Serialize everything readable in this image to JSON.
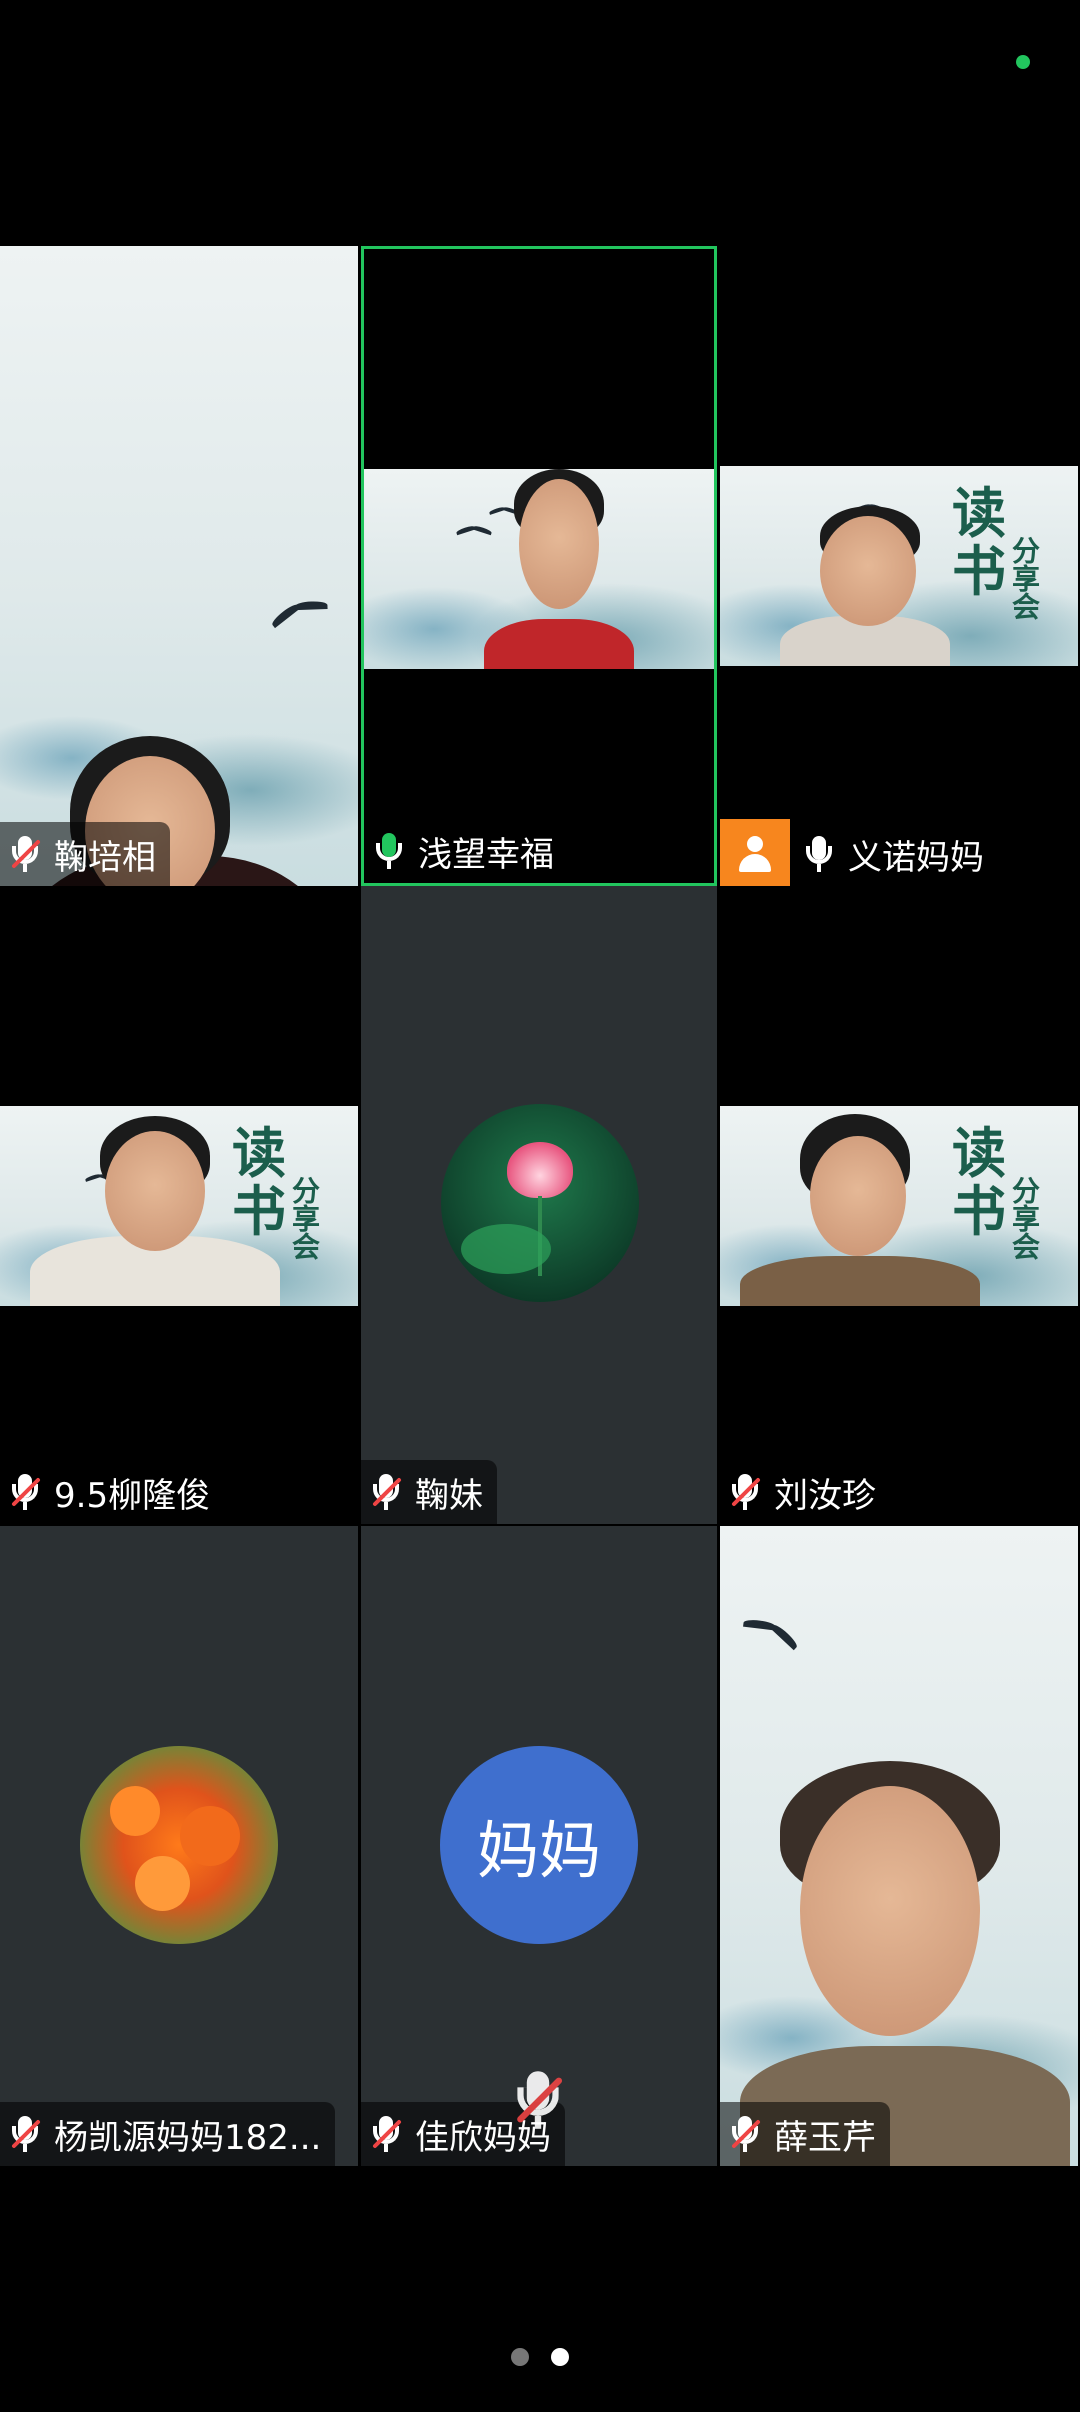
{
  "participants": [
    {
      "name": "鞠培相",
      "mic": "muted"
    },
    {
      "name": "浅望幸福",
      "mic": "on"
    },
    {
      "name": "义诺妈妈",
      "mic": "unmuted"
    },
    {
      "name": "9.5柳隆俊",
      "mic": "muted"
    },
    {
      "name": "鞠妹",
      "mic": "muted"
    },
    {
      "name": "刘汝珍",
      "mic": "muted"
    },
    {
      "name": "杨凯源妈妈182...",
      "mic": "muted"
    },
    {
      "name": "佳欣妈妈",
      "mic": "muted",
      "avatar_text": "妈妈"
    },
    {
      "name": "薛玉芹",
      "mic": "muted"
    }
  ],
  "poster": {
    "line1": "读",
    "line2": "书",
    "line3": "分享会"
  },
  "pager": {
    "pages": 2,
    "current": 2
  },
  "colors": {
    "active_border": "#22c55e",
    "avatar_blue": "#3f6fce",
    "badge_orange": "#f7861e",
    "tile_empty": "#2b3033"
  }
}
